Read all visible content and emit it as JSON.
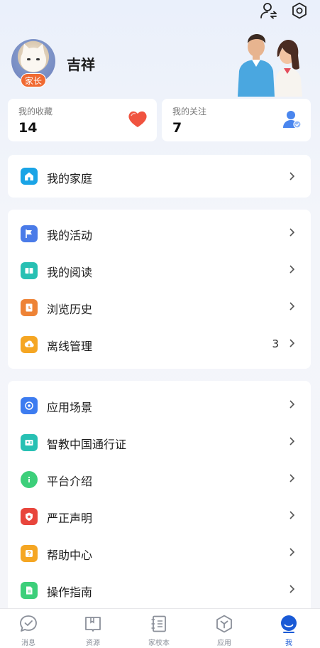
{
  "header": {
    "user_switch_icon": "user-switch-icon",
    "settings_icon": "settings-hexagon-icon"
  },
  "profile": {
    "name": "吉祥",
    "role_badge": "家长"
  },
  "stats": {
    "favorites_label": "我的收藏",
    "favorites_value": "14",
    "following_label": "我的关注",
    "following_value": "7"
  },
  "section_family": {
    "items": [
      {
        "label": "我的家庭",
        "icon": "home-icon",
        "color": "#1aa4e6"
      }
    ]
  },
  "section_personal": {
    "items": [
      {
        "label": "我的活动",
        "icon": "flag-icon",
        "color": "#4a7be8"
      },
      {
        "label": "我的阅读",
        "icon": "book-icon",
        "color": "#27c0b3"
      },
      {
        "label": "浏览历史",
        "icon": "history-icon",
        "color": "#ee8336"
      },
      {
        "label": "离线管理",
        "icon": "download-icon",
        "color": "#f5a623",
        "count": "3"
      }
    ]
  },
  "section_other": {
    "items": [
      {
        "label": "应用场景",
        "icon": "scene-icon",
        "color": "#3d7cf0"
      },
      {
        "label": "智教中国通行证",
        "icon": "id-card-icon",
        "color": "#27c0b3"
      },
      {
        "label": "平台介绍",
        "icon": "info-icon",
        "color": "#3ccf7a"
      },
      {
        "label": "严正声明",
        "icon": "shield-icon",
        "color": "#e8453c"
      },
      {
        "label": "帮助中心",
        "icon": "help-icon",
        "color": "#f5a623"
      },
      {
        "label": "操作指南",
        "icon": "guide-icon",
        "color": "#3ccf7a"
      }
    ]
  },
  "tabbar": {
    "tabs": [
      {
        "label": "消息",
        "icon": "message-icon"
      },
      {
        "label": "资源",
        "icon": "resource-book-icon"
      },
      {
        "label": "家校本",
        "icon": "notebook-icon"
      },
      {
        "label": "应用",
        "icon": "apps-hexagon-icon"
      },
      {
        "label": "我",
        "icon": "profile-icon",
        "active": true
      }
    ]
  },
  "colors": {
    "accent": "#1a5ad6",
    "badge": "#f06a32"
  }
}
